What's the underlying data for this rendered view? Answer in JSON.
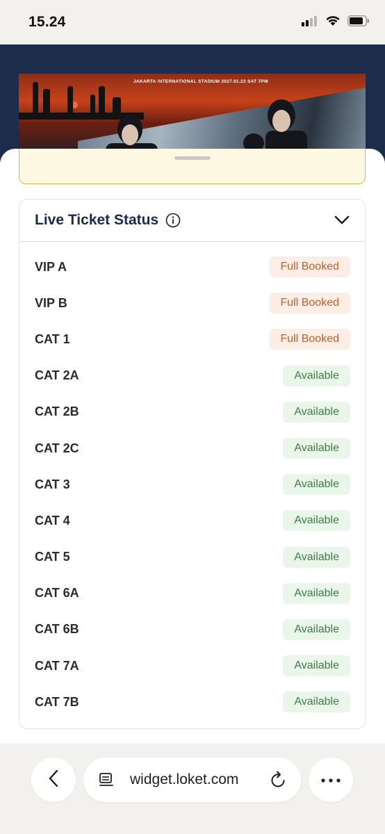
{
  "status_bar": {
    "time": "15.24",
    "icons": [
      "cellular-signal-icon",
      "wifi-icon",
      "battery-icon"
    ]
  },
  "banner": {
    "text": "JAKARTA INTERNATIONAL STADIUM 2027.01.23 SAT 7PM"
  },
  "ticket_status": {
    "title": "Live Ticket Status",
    "info_icon": "info-icon",
    "collapse_icon": "chevron-down-icon",
    "items": [
      {
        "name": "VIP A",
        "status": "Full Booked",
        "state": "full"
      },
      {
        "name": "VIP B",
        "status": "Full Booked",
        "state": "full"
      },
      {
        "name": "CAT 1",
        "status": "Full Booked",
        "state": "full"
      },
      {
        "name": "CAT 2A",
        "status": "Available",
        "state": "available"
      },
      {
        "name": "CAT 2B",
        "status": "Available",
        "state": "available"
      },
      {
        "name": "CAT 2C",
        "status": "Available",
        "state": "available"
      },
      {
        "name": "CAT 3",
        "status": "Available",
        "state": "available"
      },
      {
        "name": "CAT 4",
        "status": "Available",
        "state": "available"
      },
      {
        "name": "CAT 5",
        "status": "Available",
        "state": "available"
      },
      {
        "name": "CAT 6A",
        "status": "Available",
        "state": "available"
      },
      {
        "name": "CAT 6B",
        "status": "Available",
        "state": "available"
      },
      {
        "name": "CAT 7A",
        "status": "Available",
        "state": "available"
      },
      {
        "name": "CAT 7B",
        "status": "Available",
        "state": "available"
      }
    ]
  },
  "browser": {
    "url": "widget.loket.com",
    "back_icon": "chevron-left-icon",
    "reader_icon": "reader-mode-icon",
    "reload_icon": "reload-icon",
    "more_icon": "more-dots-icon"
  },
  "colors": {
    "header_bg": "#1b2d4a",
    "title_color": "#1a2a4f",
    "full_bg": "#fdeee5",
    "full_text": "#c0602c",
    "available_bg": "#eaf6ea",
    "available_text": "#3e7a45",
    "notice_border": "#d9b64a"
  }
}
